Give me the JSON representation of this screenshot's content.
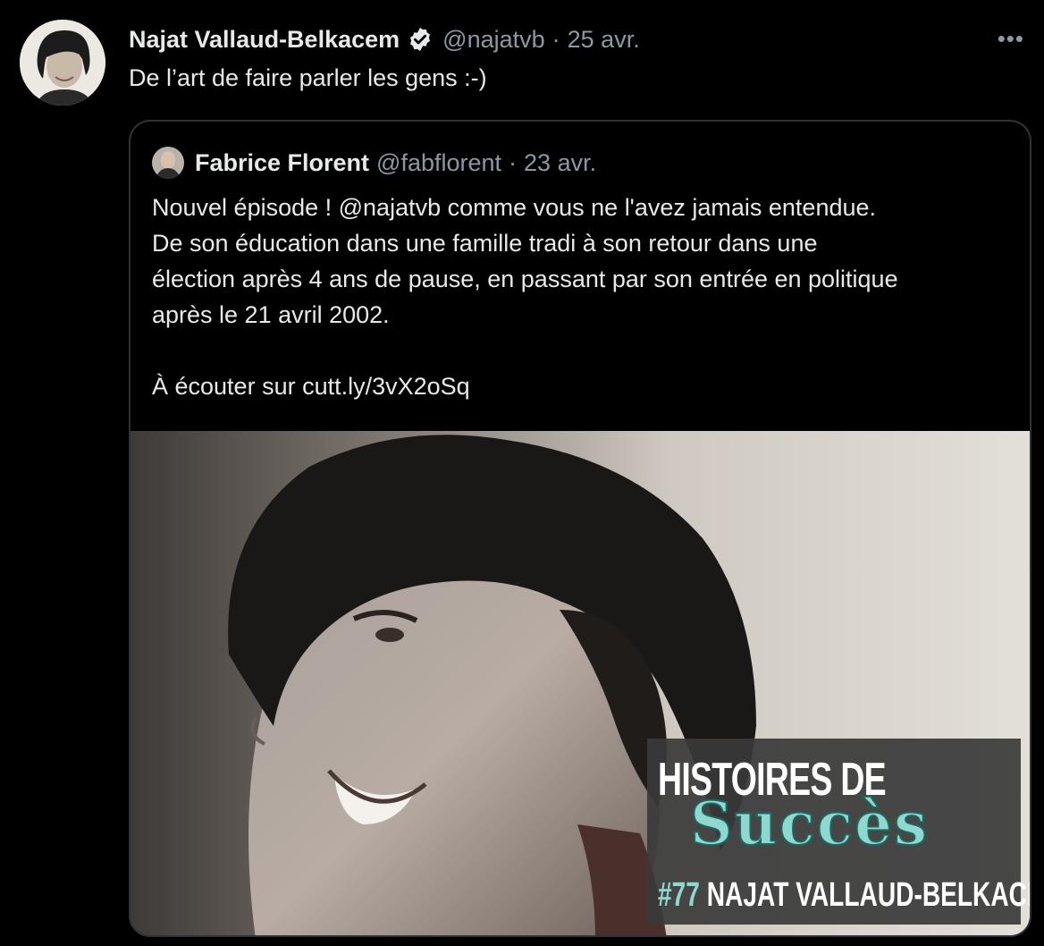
{
  "tweet": {
    "author_name": "Najat Vallaud-Belkacem",
    "handle": "@najatvb",
    "separator": "·",
    "date": "25 avr.",
    "more_label": "•••",
    "text": "De l’art de faire parler les gens :-)",
    "verified_icon": "verified-badge-icon"
  },
  "quoted": {
    "author_name": "Fabrice Florent",
    "handle": "@fabflorent",
    "separator": "·",
    "date": "23 avr.",
    "lines": [
      "Nouvel épisode ! @najatvb comme vous ne l'avez jamais entendue.",
      "De son éducation dans une famille tradi à son retour dans une",
      "élection après 4 ans de pause, en passant par son entrée en politique",
      "après le 21 avril 2002."
    ],
    "link_line": "À écouter sur cutt.ly/3vX2oSq",
    "media": {
      "badge_line1": "HISTOIRES DE",
      "badge_line2": "Succès",
      "badge_episode_number": "#77",
      "badge_episode_name": "NAJAT VALLAUD-BELKACEM"
    }
  },
  "colors": {
    "background": "#000000",
    "text_primary": "#e7e9ea",
    "text_secondary": "#8b98a5",
    "border": "#2f3336",
    "verified": "#e7e9ea",
    "badge_accent": "#8fd8d0"
  }
}
